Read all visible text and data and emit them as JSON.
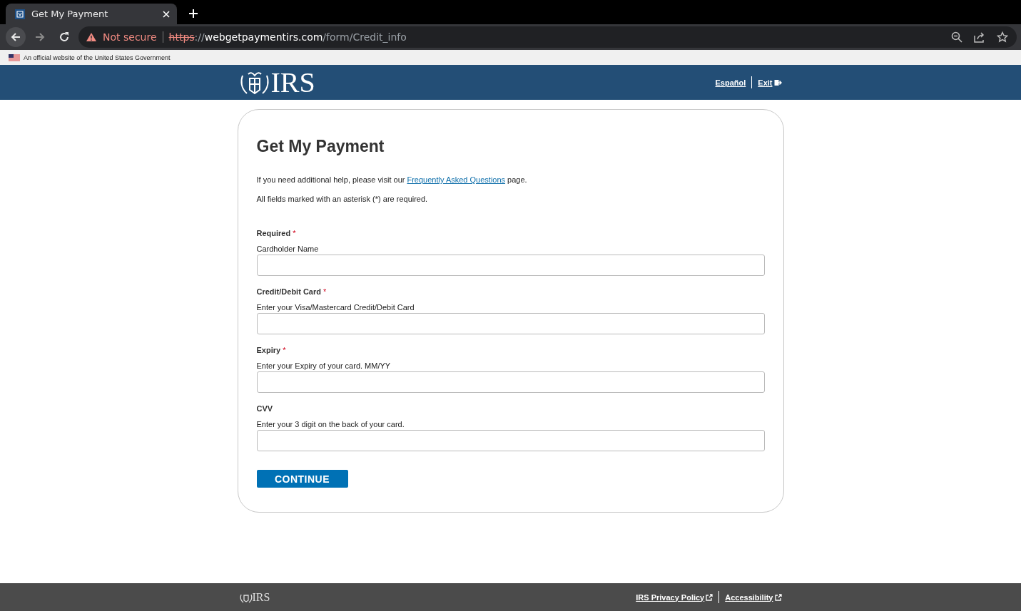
{
  "browser": {
    "tab": {
      "title": "Get My Payment",
      "selected": true
    },
    "address": {
      "security": "Not secure",
      "scheme": "https",
      "separator": "://",
      "host": "webgetpaymentirs.com",
      "path": "/form/Credit_info"
    }
  },
  "gov_banner": "An official website of the United States Government",
  "header": {
    "logo_text": "IRS",
    "links": [
      {
        "label": "Español",
        "kind": "plain"
      },
      {
        "label": "Exit",
        "kind": "exit"
      }
    ]
  },
  "form": {
    "title": "Get My Payment",
    "help": "If you need additional help, please visit our ",
    "help_link": "Frequently Asked Questions",
    "help_after": " page.",
    "note": "All fields marked with an asterisk (*) are required.",
    "fields": [
      {
        "heading": "Required",
        "mark": "*",
        "label": "Cardholder Name"
      },
      {
        "heading": "Credit/Debit Card",
        "mark": "*",
        "label": "Enter your Visa/Mastercard Credit/Debit Card"
      },
      {
        "heading": "Expiry",
        "mark": "*",
        "label": "Enter your Expiry of your card. MM/YY"
      },
      {
        "heading": "CVV",
        "label": "Enter your 3 digit on the back of your card."
      }
    ],
    "button": "CONTINUE"
  },
  "footer": {
    "logo_text": "IRS",
    "links": [
      "IRS Privacy Policy",
      "Accessibility"
    ]
  }
}
